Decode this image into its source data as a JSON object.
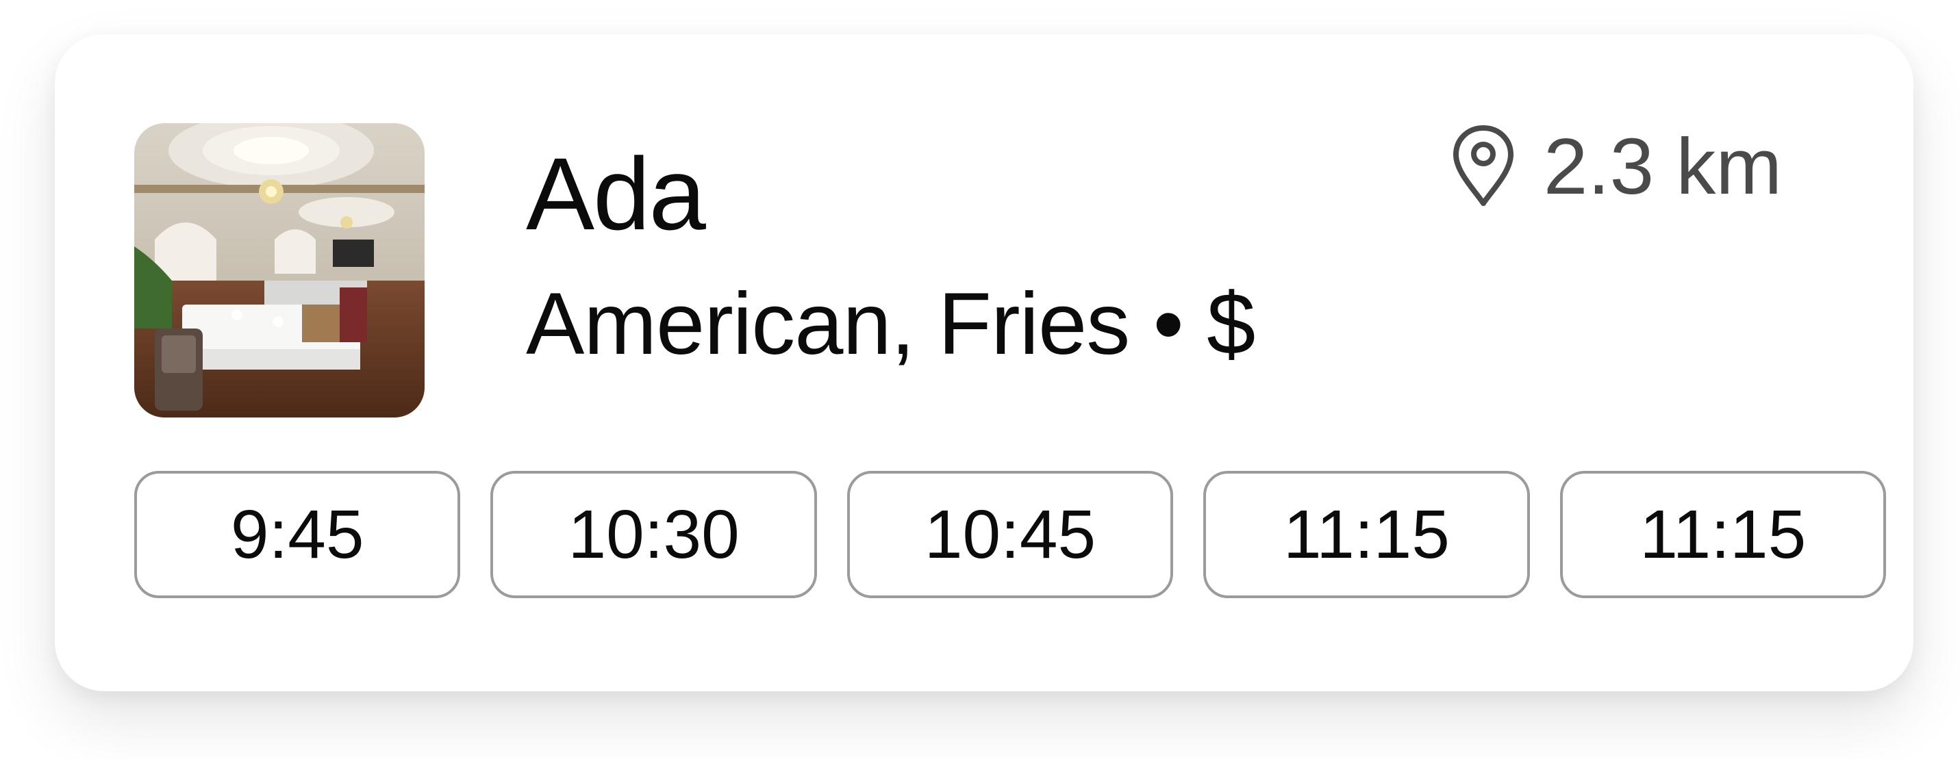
{
  "restaurant": {
    "name": "Ada",
    "cuisine_price": "American, Fries • $",
    "distance": "2.3 km",
    "thumbnail_icon": "restaurant-photo",
    "distance_icon": "location-pin-icon"
  },
  "time_slots": [
    "9:45",
    "10:30",
    "10:45",
    "11:15",
    "11:15"
  ],
  "colors": {
    "text": "#0b0b0b",
    "secondary_text": "#4a4a4a",
    "slot_border": "#9b9b9b",
    "card_background": "#ffffff"
  }
}
